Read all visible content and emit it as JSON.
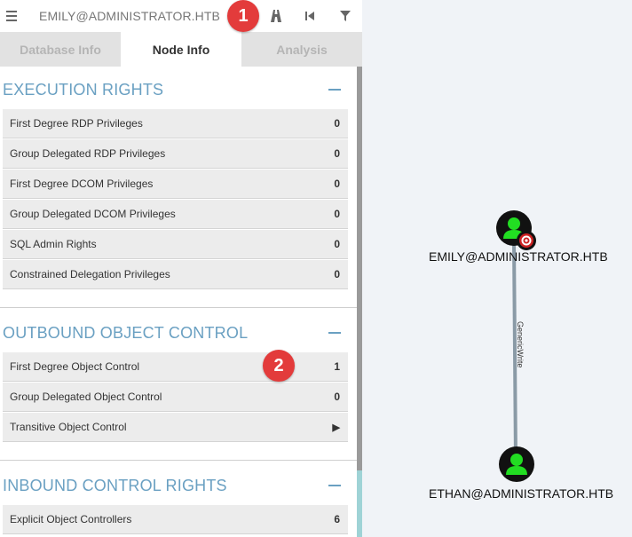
{
  "topbar": {
    "search_value": "EMILY@ADMINISTRATOR.HTB",
    "icons": [
      "menu-icon",
      "path-icon",
      "back-icon",
      "filter-icon"
    ]
  },
  "tabs": [
    {
      "label": "Database Info",
      "active": false
    },
    {
      "label": "Node Info",
      "active": true
    },
    {
      "label": "Analysis",
      "active": false
    }
  ],
  "sections": {
    "execution": {
      "title": "EXECUTION RIGHTS",
      "rows": [
        {
          "label": "First Degree RDP Privileges",
          "value": "0"
        },
        {
          "label": "Group Delegated RDP Privileges",
          "value": "0"
        },
        {
          "label": "First Degree DCOM Privileges",
          "value": "0"
        },
        {
          "label": "Group Delegated DCOM Privileges",
          "value": "0"
        },
        {
          "label": "SQL Admin Rights",
          "value": "0"
        },
        {
          "label": "Constrained Delegation Privileges",
          "value": "0"
        }
      ]
    },
    "outbound": {
      "title": "OUTBOUND OBJECT CONTROL",
      "rows": [
        {
          "label": "First Degree Object Control",
          "value": "1"
        },
        {
          "label": "Group Delegated Object Control",
          "value": "0"
        },
        {
          "label": "Transitive Object Control",
          "value": "▶"
        }
      ]
    },
    "inbound": {
      "title": "INBOUND CONTROL RIGHTS",
      "rows": [
        {
          "label": "Explicit Object Controllers",
          "value": "6"
        }
      ]
    }
  },
  "badges": [
    "1",
    "2"
  ],
  "graph": {
    "nodes": [
      {
        "label": "EMILY@ADMINISTRATOR.HTB"
      },
      {
        "label": "ETHAN@ADMINISTRATOR.HTB"
      }
    ],
    "edge_label": "GenericWrite",
    "colors": {
      "node_fill": "#111111",
      "user_glyph": "#22dd22",
      "target_ring": "#cc2222",
      "edge": "#8a9aa6"
    }
  }
}
